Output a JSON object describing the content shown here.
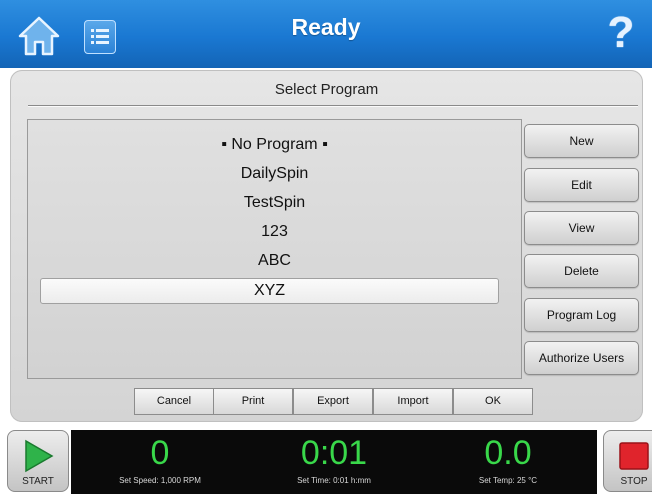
{
  "header": {
    "title": "Ready",
    "help_symbol": "?",
    "home_icon": "home-icon",
    "list_icon": "list-icon"
  },
  "main": {
    "heading": "Select Program",
    "programs": [
      "▪ No Program ▪",
      "DailySpin",
      "TestSpin",
      "123",
      "ABC",
      "XYZ"
    ],
    "selected_program": "XYZ",
    "side_buttons": {
      "new": "New",
      "edit": "Edit",
      "view": "View",
      "delete": "Delete",
      "program_log": "Program Log",
      "authorize_users": "Authorize Users"
    },
    "bottom_tabs": {
      "cancel": "Cancel",
      "print": "Print",
      "export": "Export",
      "import": "Import",
      "ok": "OK"
    }
  },
  "footer": {
    "start_label": "START",
    "stop_label": "STOP",
    "speed": {
      "value": "0",
      "caption": "Set Speed: 1,000 RPM"
    },
    "time": {
      "value": "0:01",
      "caption": "Set Time: 0:01 h:mm"
    },
    "temp": {
      "value": "0.0",
      "caption": "Set Temp: 25 °C"
    }
  },
  "colors": {
    "header_blue": "#1a78d2",
    "readout_green": "#39d84a",
    "start_green": "#2fb34a",
    "stop_red": "#e0242c"
  }
}
